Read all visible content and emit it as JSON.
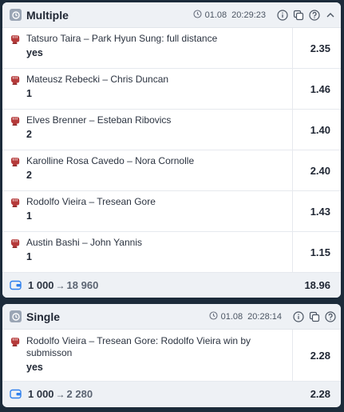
{
  "multiple": {
    "title": "Multiple",
    "date": "01.08",
    "time": "20:29:23",
    "bets": [
      {
        "event": "Tatsuro Taira – Park Hyun Sung: full distance",
        "outcome": "yes",
        "odd": "2.35"
      },
      {
        "event": "Mateusz Rebecki – Chris Duncan",
        "outcome": "1",
        "odd": "1.46"
      },
      {
        "event": "Elves Brenner – Esteban Ribovics",
        "outcome": "2",
        "odd": "1.40"
      },
      {
        "event": "Karolline Rosa Cavedo – Nora Cornolle",
        "outcome": "2",
        "odd": "2.40"
      },
      {
        "event": "Rodolfo Vieira – Tresean Gore",
        "outcome": "1",
        "odd": "1.43"
      },
      {
        "event": "Austin Bashi – John Yannis",
        "outcome": "1",
        "odd": "1.15"
      }
    ],
    "footer": {
      "stake": "1 000",
      "arrow": "→",
      "payout": "18 960",
      "total_odd": "18.96"
    }
  },
  "single": {
    "title": "Single",
    "date": "01.08",
    "time": "20:28:14",
    "bets": [
      {
        "event": "Rodolfo Vieira – Tresean Gore: Rodolfo Vieira win by submisson",
        "outcome": "yes",
        "odd": "2.28"
      }
    ],
    "footer": {
      "stake": "1 000",
      "arrow": "→",
      "payout": "2 280",
      "total_odd": "2.28"
    }
  },
  "icons": {
    "type": "clock-icon",
    "date": "clock-icon",
    "info": "info-icon",
    "copy": "copy-icon",
    "help": "help-icon",
    "collapse": "chevron-up-icon",
    "sport": "mma-glove-icon",
    "wallet": "wallet-icon"
  },
  "colors": {
    "page_bg": "#1c2b3a",
    "header_bg": "#eef1f5",
    "sport_icon": "#b53a3a",
    "wallet_icon": "#2f80ed"
  }
}
